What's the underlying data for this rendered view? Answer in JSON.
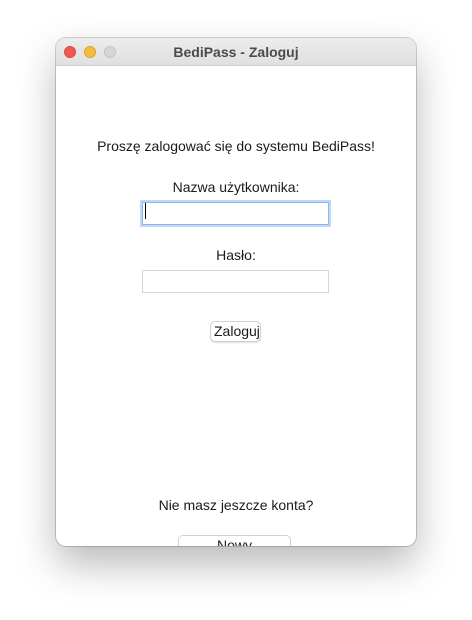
{
  "window": {
    "title": "BediPass - Zaloguj"
  },
  "login": {
    "prompt": "Proszę zalogować się do systemu BediPass!",
    "username_label": "Nazwa użytkownika:",
    "username_value": "",
    "password_label": "Hasło:",
    "password_value": "",
    "submit_label": "Zaloguj"
  },
  "register": {
    "question": "Nie masz jeszcze konta?",
    "button_label": "Nowy użytkownik"
  },
  "colors": {
    "close": "#ee5a52",
    "minimize": "#f4bd3f",
    "zoom": "#d6d6d6",
    "focus_ring": "#8fb6e8"
  }
}
